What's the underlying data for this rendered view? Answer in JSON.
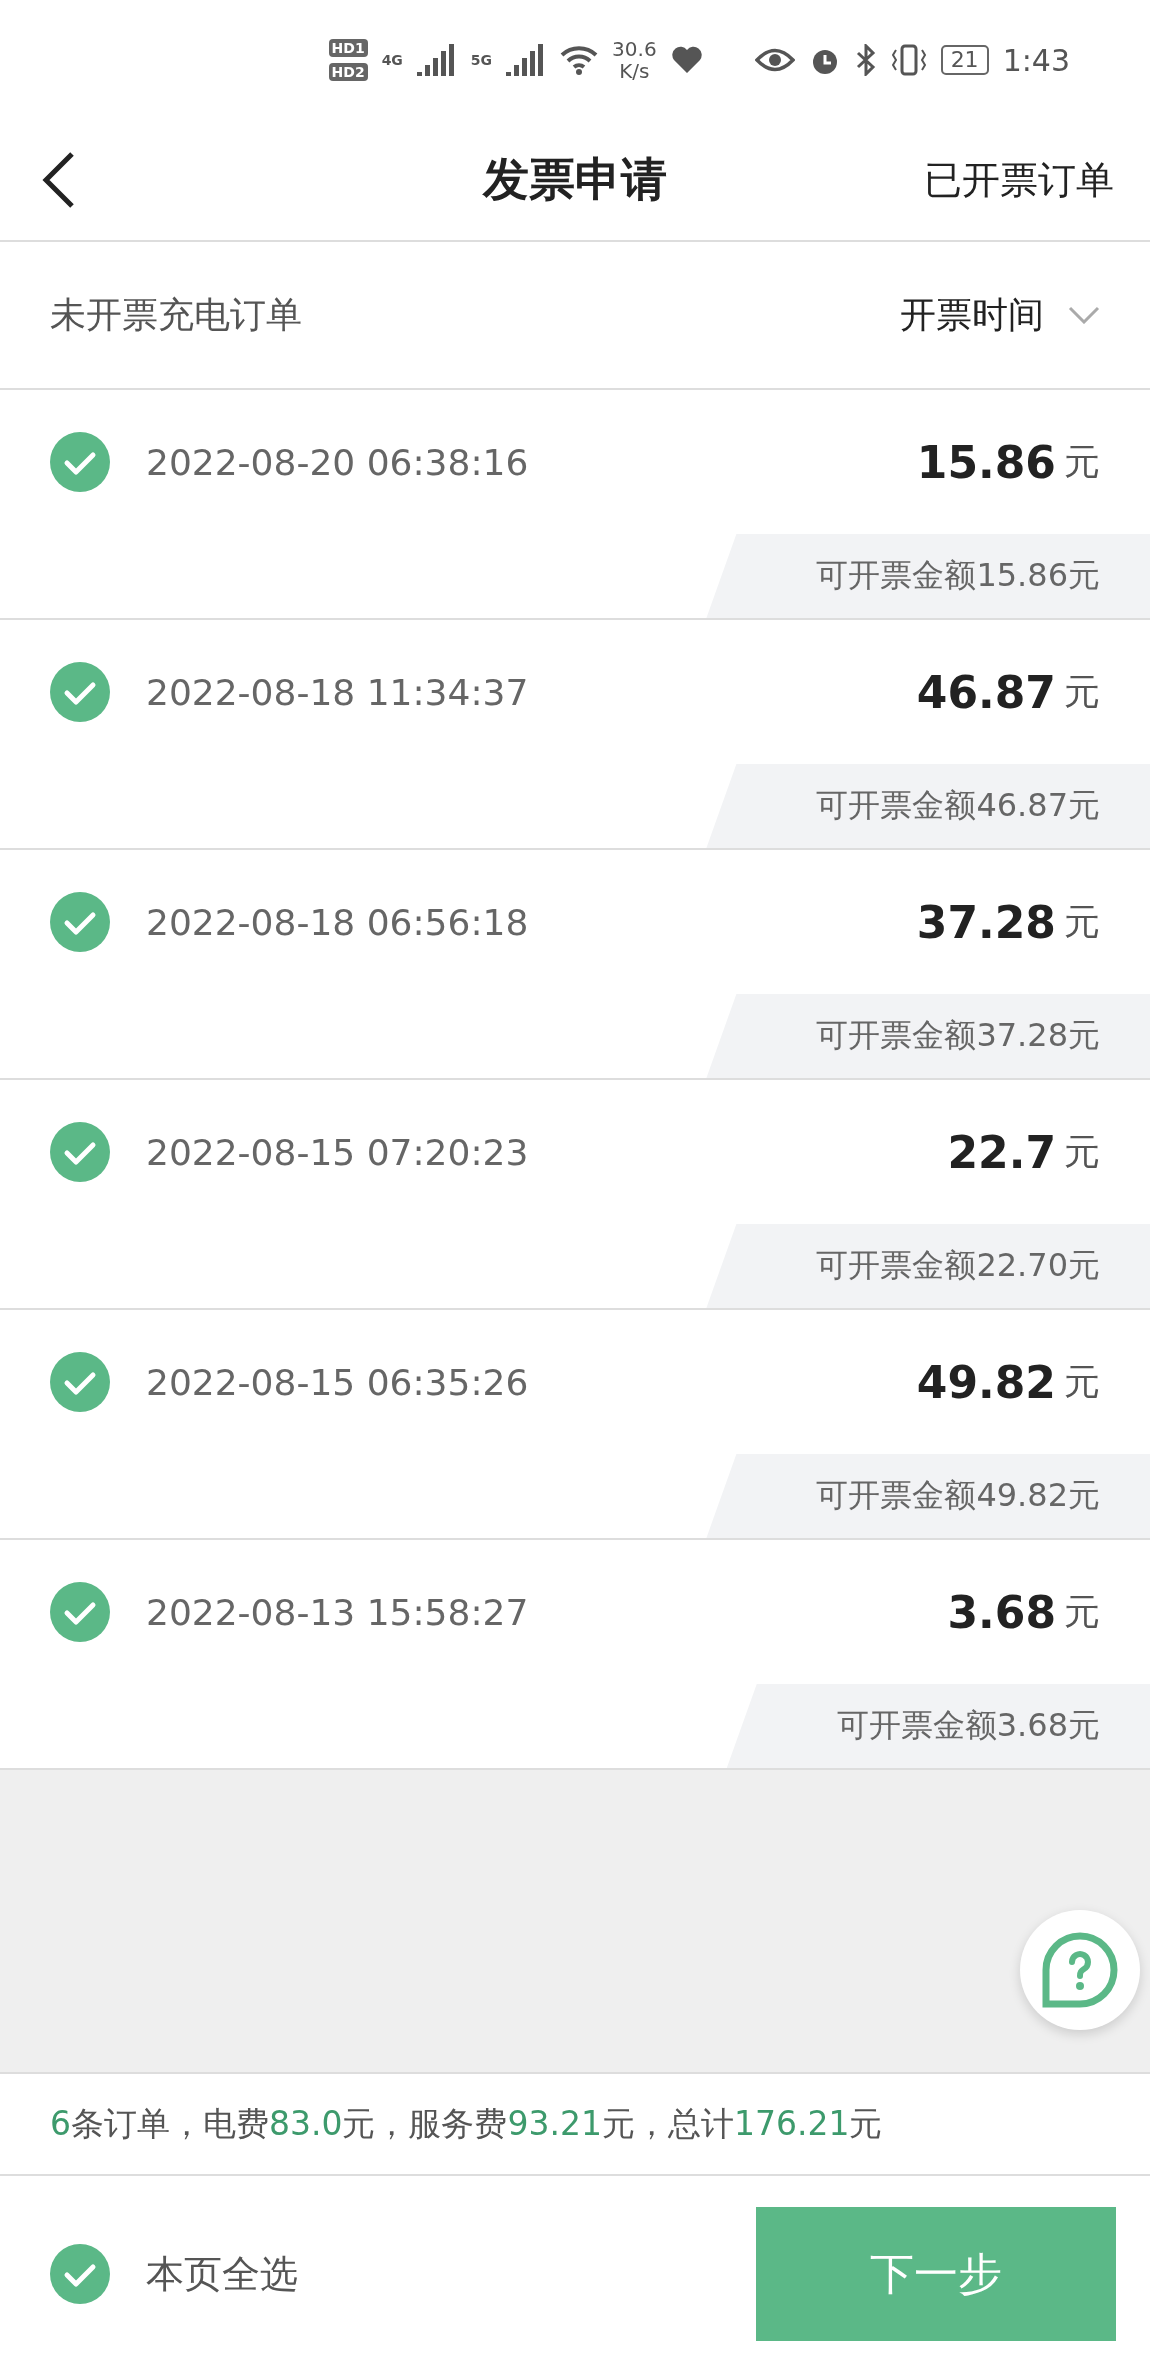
{
  "status_bar": {
    "hd_badges": [
      {
        "label": "HD",
        "sim": "1"
      },
      {
        "label": "HD",
        "sim": "2"
      }
    ],
    "networks": [
      "4G",
      "5G"
    ],
    "speed": "30.6",
    "speed_unit": "K/s",
    "battery": "21",
    "time": "1:43"
  },
  "header": {
    "title": "发票申请",
    "action": "已开票订单"
  },
  "filter": {
    "label": "未开票充电订单",
    "sort": "开票时间"
  },
  "orders": [
    {
      "time": "2022-08-20 06:38:16",
      "amount": "15.86",
      "unit": "元",
      "invoiceable": "可开票金额15.86元",
      "checked": true
    },
    {
      "time": "2022-08-18 11:34:37",
      "amount": "46.87",
      "unit": "元",
      "invoiceable": "可开票金额46.87元",
      "checked": true
    },
    {
      "time": "2022-08-18 06:56:18",
      "amount": "37.28",
      "unit": "元",
      "invoiceable": "可开票金额37.28元",
      "checked": true
    },
    {
      "time": "2022-08-15 07:20:23",
      "amount": "22.7",
      "unit": "元",
      "invoiceable": "可开票金额22.70元",
      "checked": true
    },
    {
      "time": "2022-08-15 06:35:26",
      "amount": "49.82",
      "unit": "元",
      "invoiceable": "可开票金额49.82元",
      "checked": true
    },
    {
      "time": "2022-08-13 15:58:27",
      "amount": "3.68",
      "unit": "元",
      "invoiceable": "可开票金额3.68元",
      "checked": true
    }
  ],
  "summary": [
    {
      "text": "6",
      "highlight": true
    },
    {
      "text": "条订单，电费",
      "highlight": false
    },
    {
      "text": "83.0",
      "highlight": true
    },
    {
      "text": "元，服务费",
      "highlight": false
    },
    {
      "text": "93.21",
      "highlight": true
    },
    {
      "text": "元，总计",
      "highlight": false
    },
    {
      "text": "176.21",
      "highlight": true
    },
    {
      "text": "元",
      "highlight": false
    }
  ],
  "footer": {
    "select_all": {
      "label": "本页全选",
      "checked": true
    },
    "next_button": "下一步"
  }
}
